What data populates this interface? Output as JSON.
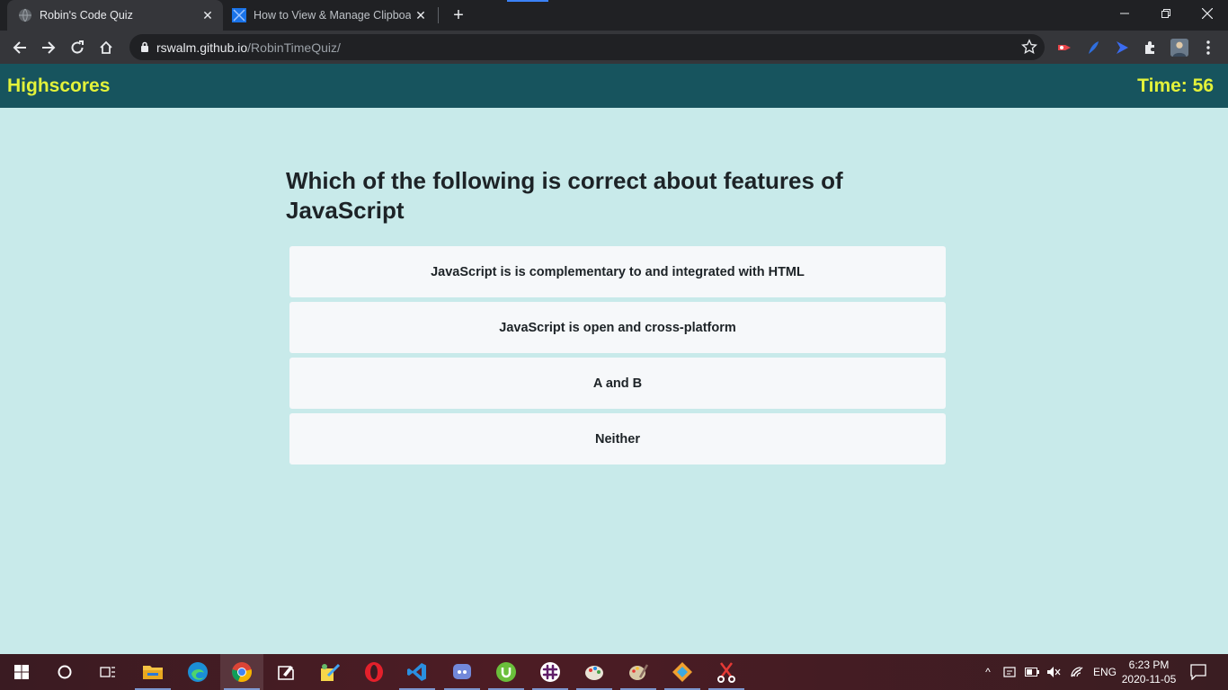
{
  "browser": {
    "tabs": [
      {
        "title": "Robin's Code Quiz",
        "active": true
      },
      {
        "title": "How to View & Manage Clipboar",
        "active": false
      }
    ],
    "url_host": "rswalm.github.io",
    "url_path": "/RobinTimeQuiz/"
  },
  "page": {
    "highscores_label": "Highscores",
    "timer_label": "Time: 56",
    "question": "Which of the following is correct about features of JavaScript",
    "choices": [
      "JavaScript is is complementary to and integrated with HTML",
      "JavaScript is open and cross-platform",
      "A and B",
      "Neither"
    ]
  },
  "taskbar": {
    "language": "ENG",
    "time": "6:23 PM",
    "date": "2020-11-05"
  },
  "colors": {
    "header_bg": "#17545e",
    "accent_yellow": "#e3f23a",
    "page_bg": "#c8eaea",
    "choice_bg": "#f6f8fa"
  }
}
